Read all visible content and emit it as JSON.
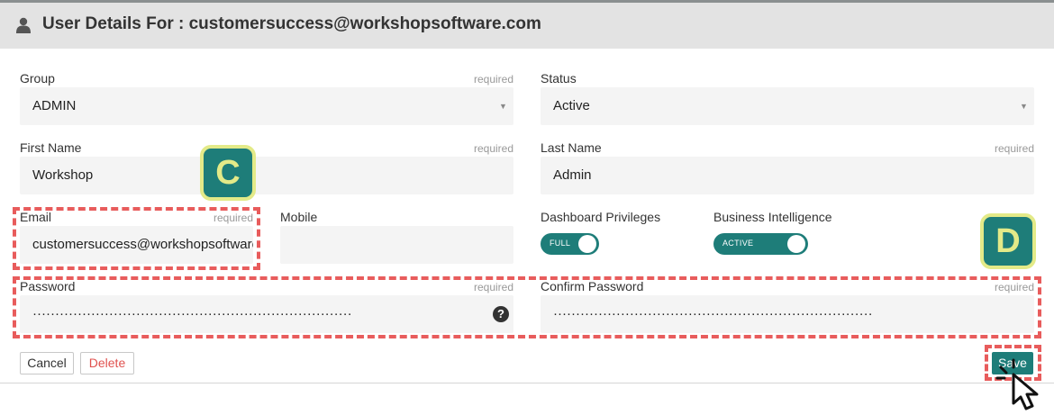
{
  "header": {
    "title": "User Details For : customersuccess@workshopsoftware.com"
  },
  "form": {
    "group": {
      "label": "Group",
      "required": "required",
      "value": "ADMIN"
    },
    "status": {
      "label": "Status",
      "value": "Active"
    },
    "first_name": {
      "label": "First Name",
      "required": "required",
      "value": "Workshop"
    },
    "last_name": {
      "label": "Last Name",
      "required": "required",
      "value": "Admin"
    },
    "email": {
      "label": "Email",
      "required": "required",
      "value": "customersuccess@workshopsoftware.com"
    },
    "mobile": {
      "label": "Mobile",
      "value": ""
    },
    "dashboard_privileges": {
      "label": "Dashboard Privileges",
      "toggle_text": "FULL"
    },
    "business_intelligence": {
      "label": "Business Intelligence",
      "toggle_text": "ACTIVE"
    },
    "password": {
      "label": "Password",
      "required": "required",
      "value": "·······································································"
    },
    "confirm_password": {
      "label": "Confirm Password",
      "required": "required",
      "value": "·······································································"
    }
  },
  "help_glyph": "?",
  "buttons": {
    "cancel": "Cancel",
    "delete": "Delete",
    "save": "Save"
  },
  "annotations": {
    "badge_c": "C",
    "badge_d": "D"
  },
  "colors": {
    "accent": "#1e7d79",
    "highlight": "#e85c5c",
    "badge_border": "#e3ea88",
    "delete": "#e0524f"
  }
}
